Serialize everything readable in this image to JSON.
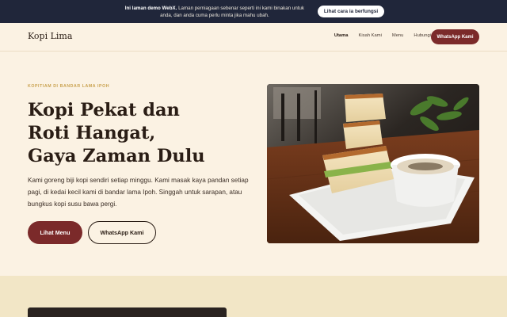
{
  "banner": {
    "bold": "Ini laman demo WebX.",
    "text": "Laman perniagaan sebenar seperti ini kami binakan untuk anda, dan anda cuma perlu minta jika mahu ubah.",
    "button": "Lihat cara ia berfungsi"
  },
  "nav": {
    "brand": "Kopi Lima",
    "links": [
      "Utama",
      "Kisah Kami",
      "Menu",
      "Hubungi"
    ],
    "cta": "WhatsApp Kami"
  },
  "hero": {
    "eyebrow": "KOPITIAM DI BANDAR LAMA IPOH",
    "title_lines": [
      "Kopi Pekat dan",
      "Roti Hangat,",
      "Gaya Zaman Dulu"
    ],
    "description": "Kami goreng biji kopi sendiri setiap minggu. Kami masak kaya pandan setiap pagi, di kedai kecil kami di bandar lama Ipoh. Singgah untuk sarapan, atau bungkus kopi susu bawa pergi.",
    "primary_button": "Lihat Menu",
    "secondary_button": "WhatsApp Kami"
  },
  "colors": {
    "banner_bg": "#20263a",
    "page_bg": "#fbf2e3",
    "accent": "#7b2a2a",
    "eyebrow": "#c9a24f",
    "section_bg": "#f2e6c6"
  }
}
